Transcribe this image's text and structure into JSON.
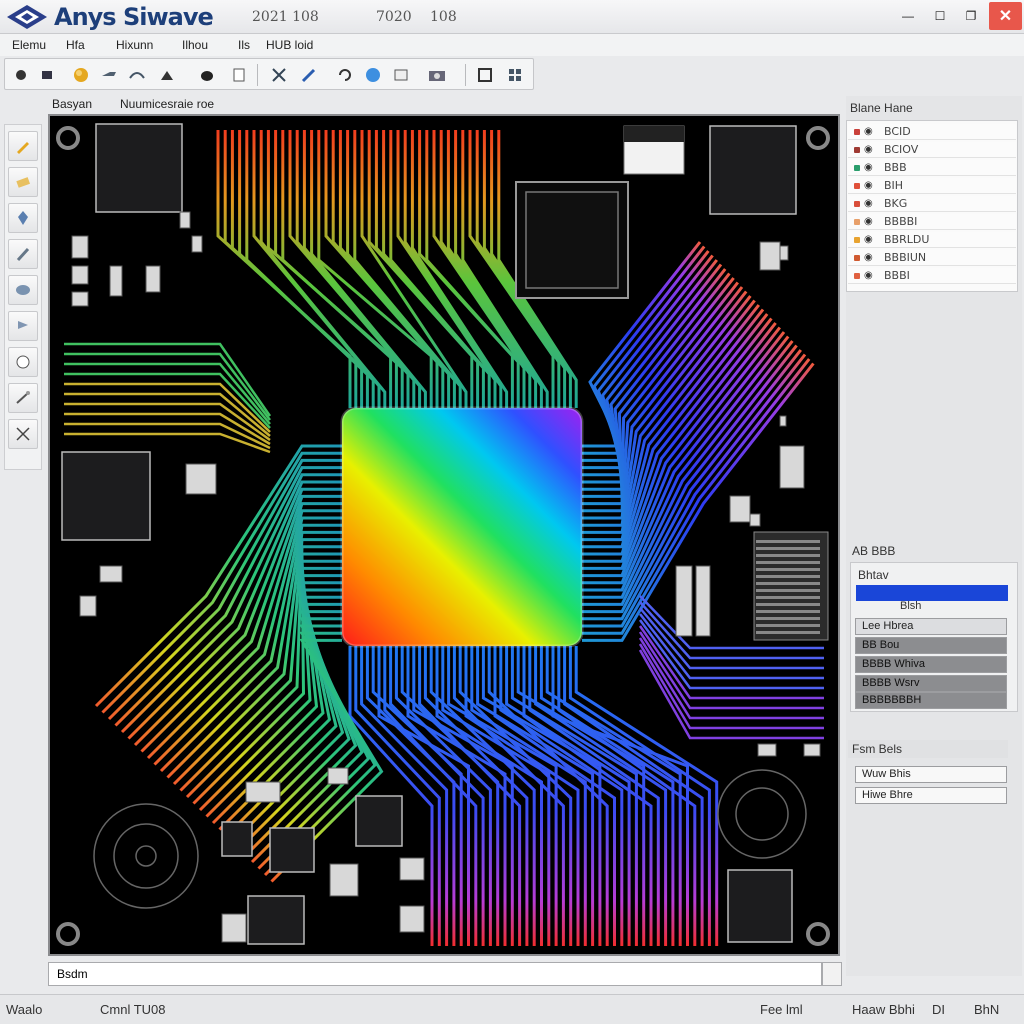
{
  "window": {
    "title": "Anys Siwave",
    "meta": [
      "2021 108",
      "7020",
      "108"
    ],
    "controls": {
      "minimize": "—",
      "maximize": "☐",
      "restore": "❐",
      "close": "✕"
    }
  },
  "menu": [
    "Elemu",
    "Hfa",
    "Hixunn",
    "Ilhou",
    "Ils",
    "HUB loid"
  ],
  "toolbar_icons": [
    "circle-icon",
    "square-icon",
    "sphere-icon",
    "probe-icon",
    "wave-icon",
    "sphere-dark-icon",
    "circle-dark-icon",
    "board-icon",
    "cut-icon",
    "pen-icon",
    "rotate-icon",
    "globe-icon",
    "box-icon",
    "camera-icon",
    "frame-icon",
    "grid-icon"
  ],
  "subheader": {
    "left": "Basyan",
    "right": "Nuumicesraie roe"
  },
  "left_tools": [
    "pencil-icon",
    "eraser-icon",
    "pin-icon",
    "shovel-icon",
    "disc-icon",
    "flag-icon",
    "circle-cut-icon",
    "wand-icon",
    "measure-icon"
  ],
  "layers_panel": {
    "title": "Blane Hane",
    "rows": [
      {
        "label": "BCID",
        "color": "#c9403a"
      },
      {
        "label": "BCIOV",
        "color": "#9f3a33"
      },
      {
        "label": "BBB",
        "color": "#2a9d6c"
      },
      {
        "label": "BIH",
        "color": "#e0503a"
      },
      {
        "label": "BKG",
        "color": "#d94e3a"
      },
      {
        "label": "BBBBI",
        "color": "#e8a06a"
      },
      {
        "label": "BBRLDU",
        "color": "#e8a330"
      },
      {
        "label": "BBBIUN",
        "color": "#d05a30"
      },
      {
        "label": "BBBI",
        "color": "#e06040"
      }
    ]
  },
  "props_panel": {
    "header": "AB BBB",
    "title": "Bhtav",
    "selected": "Blsh",
    "rows": [
      "Lee Hbrea",
      "BB Bou",
      "BBBB Whiva",
      "BBBB Wsrv",
      "BBBBBBBH"
    ]
  },
  "analysis_panel": {
    "title": "Fsm Bels",
    "rows": [
      "Wuw Bhis",
      "Hiwe Bhre"
    ]
  },
  "command_input": "Bsdm",
  "status": {
    "left": "Waalo",
    "center": "Cmnl TU08",
    "right": [
      "Fee lml",
      "Haaw Bbhi",
      "DI",
      "BhN"
    ]
  }
}
